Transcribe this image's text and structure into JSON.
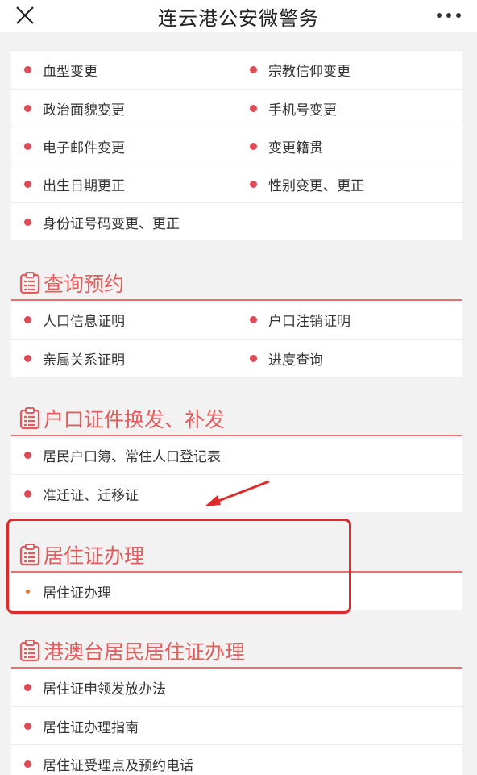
{
  "nav": {
    "title": "连云港公安微警务",
    "close_icon": "close-icon",
    "more_icon": "more-dots-icon"
  },
  "top_list": {
    "rows": [
      [
        {
          "label": "血型变更"
        },
        {
          "label": "宗教信仰变更"
        }
      ],
      [
        {
          "label": "政治面貌变更"
        },
        {
          "label": "手机号变更"
        }
      ],
      [
        {
          "label": "电子邮件变更"
        },
        {
          "label": "变更籍贯"
        }
      ],
      [
        {
          "label": "出生日期更正"
        },
        {
          "label": "性别变更、更正"
        }
      ],
      [
        {
          "label": "身份证号码变更、更正"
        }
      ]
    ]
  },
  "sections": [
    {
      "title": "查询预约",
      "rows": [
        [
          {
            "label": "人口信息证明"
          },
          {
            "label": "户口注销证明"
          }
        ],
        [
          {
            "label": "亲属关系证明"
          },
          {
            "label": "进度查询"
          }
        ]
      ]
    },
    {
      "title": "户口证件换发、补发",
      "rows": [
        [
          {
            "label": "居民户口簿、常住人口登记表"
          }
        ],
        [
          {
            "label": "准迁证、迁移证"
          }
        ]
      ]
    },
    {
      "title": "居住证办理",
      "rows": [
        [
          {
            "label": "居住证办理"
          }
        ]
      ]
    },
    {
      "title": "港澳台居民居住证办理",
      "rows": [
        [
          {
            "label": "居住证申领发放办法"
          }
        ],
        [
          {
            "label": "居住证办理指南"
          }
        ],
        [
          {
            "label": "居住证受理点及预约电话"
          }
        ]
      ]
    }
  ],
  "colors": {
    "accent": "#e45c5c",
    "bullet": "#dd4b57",
    "annotation": "#e02a2a"
  }
}
